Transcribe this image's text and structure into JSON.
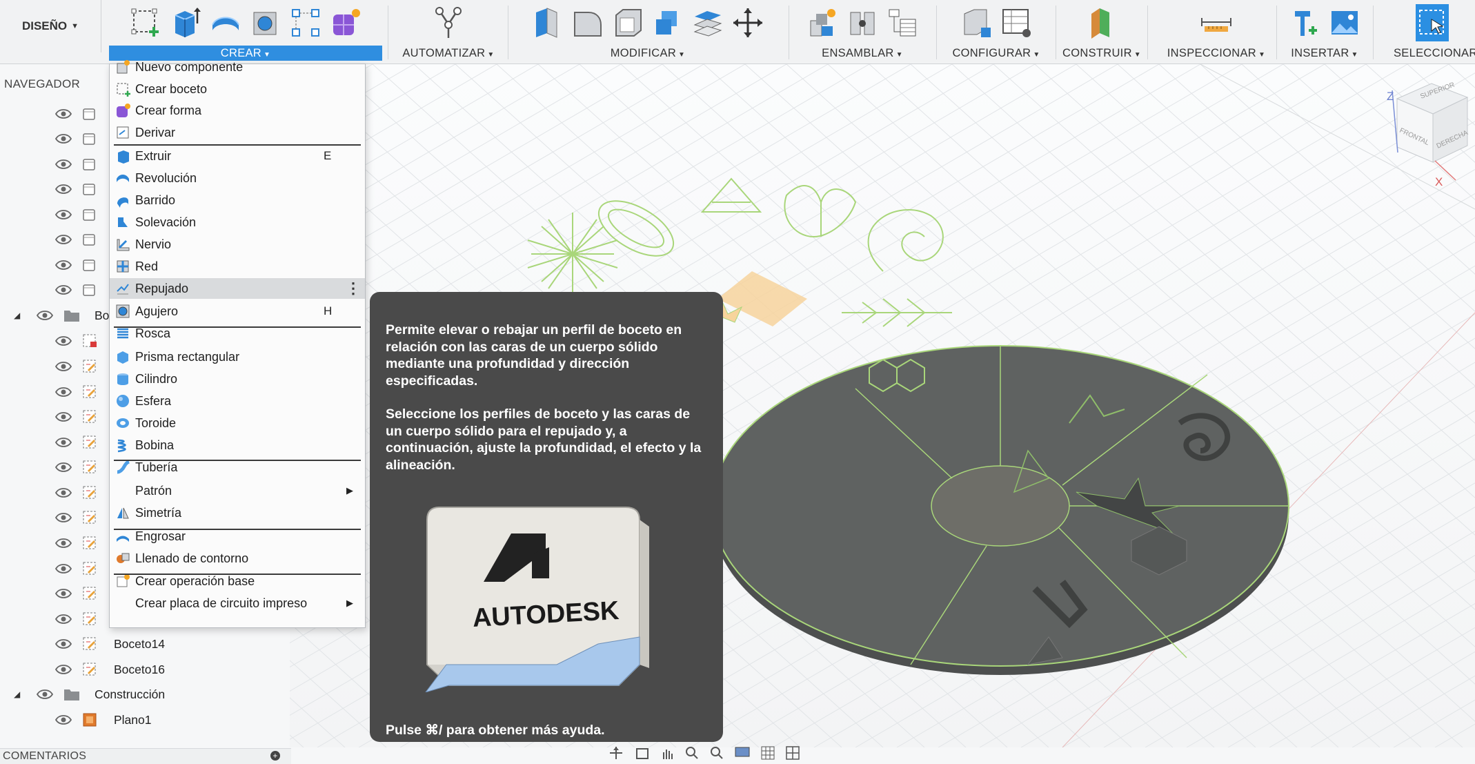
{
  "workspace": {
    "label": "DISEÑO"
  },
  "toolbar": {
    "groups": [
      {
        "label": "CREAR"
      },
      {
        "label": "AUTOMATIZAR"
      },
      {
        "label": "MODIFICAR"
      },
      {
        "label": "ENSAMBLAR"
      },
      {
        "label": "CONFIGURAR"
      },
      {
        "label": "CONSTRUIR"
      },
      {
        "label": "INSPECCIONAR"
      },
      {
        "label": "INSERTAR"
      },
      {
        "label": "SELECCIONAR"
      }
    ]
  },
  "navigator": {
    "title": "NAVEGADOR",
    "folder_bodies_label": "Bo",
    "sketch_14": "Boceto14",
    "sketch_16": "Boceto16",
    "folder_construction": "Construcción",
    "plane_1": "Plano1"
  },
  "comments": {
    "label": "COMENTARIOS"
  },
  "menu": {
    "items": [
      {
        "label": "Nuevo componente"
      },
      {
        "label": "Crear boceto"
      },
      {
        "label": "Crear forma"
      },
      {
        "label": "Derivar"
      },
      {
        "label": "Extruir",
        "shortcut": "E"
      },
      {
        "label": "Revolución"
      },
      {
        "label": "Barrido"
      },
      {
        "label": "Solevación"
      },
      {
        "label": "Nervio"
      },
      {
        "label": "Red"
      },
      {
        "label": "Repujado"
      },
      {
        "label": "Agujero",
        "shortcut": "H"
      },
      {
        "label": "Rosca"
      },
      {
        "label": "Prisma rectangular"
      },
      {
        "label": "Cilindro"
      },
      {
        "label": "Esfera"
      },
      {
        "label": "Toroide"
      },
      {
        "label": "Bobina"
      },
      {
        "label": "Tubería"
      },
      {
        "label": "Patrón"
      },
      {
        "label": "Simetría"
      },
      {
        "label": "Engrosar"
      },
      {
        "label": "Llenado de contorno"
      },
      {
        "label": "Crear operación base"
      },
      {
        "label": "Crear placa de circuito impreso"
      }
    ]
  },
  "tooltip": {
    "p1": "Permite elevar o rebajar un perfil de boceto en relación con las caras de un cuerpo sólido mediante una profundidad y dirección especificadas.",
    "p2": "Seleccione los perfiles de boceto y las caras de un cuerpo sólido para el repujado y, a continuación, ajuste la profundidad, el efecto y la alineación.",
    "image_text": "AUTODESK",
    "footer": "Pulse ⌘/ para obtener más ayuda."
  },
  "viewcube": {
    "top": "SUPERIOR",
    "front": "FRONTAL",
    "right": "DERECHA",
    "axis_z": "Z",
    "axis_x": "X"
  },
  "colors": {
    "accent": "#2f8ee0",
    "tooltip_bg": "#4a4a4a",
    "sketch": "#9fd27a",
    "body": "#5e6160"
  }
}
